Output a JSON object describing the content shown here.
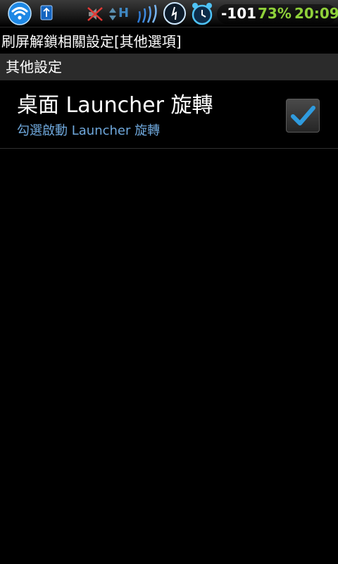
{
  "status_bar": {
    "signal": "-101",
    "battery": "73%",
    "time": "20:09",
    "network_type": "H",
    "icons": [
      "wifi-icon",
      "usb-icon",
      "muted-speaker-icon",
      "data-arrows-icon",
      "signal-waves-icon",
      "gauge-icon",
      "alarm-clock-icon"
    ]
  },
  "title": "刷屏解鎖相關設定[其他選項]",
  "section": {
    "label": "其他設定"
  },
  "setting": {
    "title": "桌面 Launcher 旋轉",
    "summary": "勾選啟動 Launcher 旋轉",
    "checked": true
  },
  "colors": {
    "accent_blue": "#6fa8dc",
    "battery_green": "#8fd13a",
    "check_blue": "#2f9bde"
  }
}
